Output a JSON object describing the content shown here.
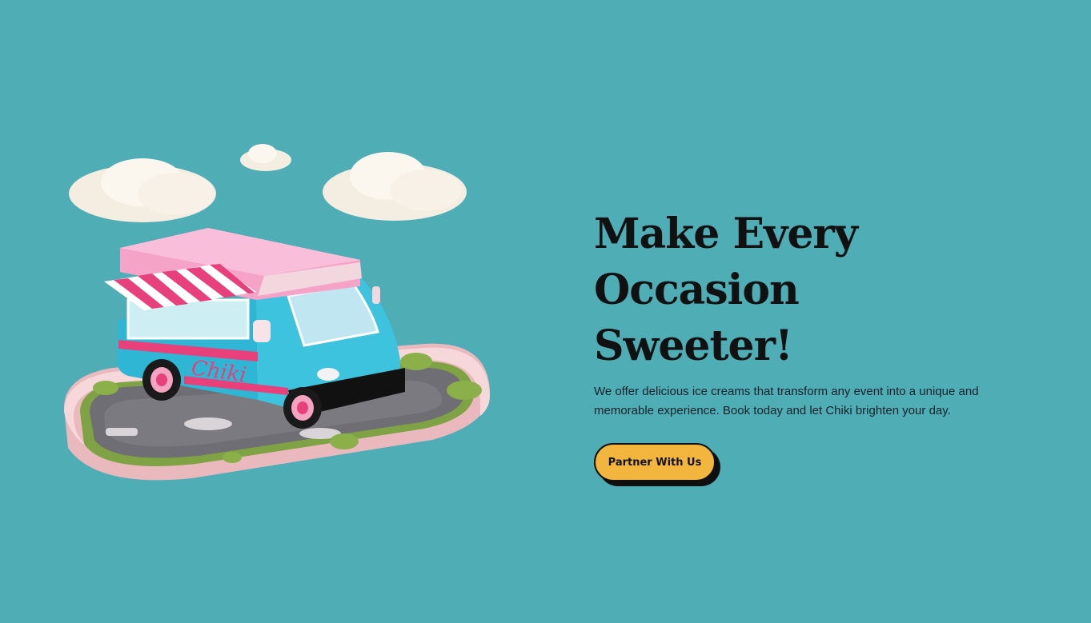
{
  "hero": {
    "headline_line1": "Make Every",
    "headline_line2": "Occasion Sweeter!",
    "description": "We offer delicious ice creams that transform any event into a unique and memorable experience. Book today and let Chiki brighten your day.",
    "cta_label": "Partner With Us",
    "illustration": {
      "truck_lettering": "Chiki"
    }
  },
  "colors": {
    "background": "#4FADB5",
    "cta_fill": "#F2B63E",
    "text": "#111111",
    "truck_body": "#2FB6D4",
    "truck_roof": "#F6A3C8",
    "awning_stripe": "#E8407A"
  }
}
